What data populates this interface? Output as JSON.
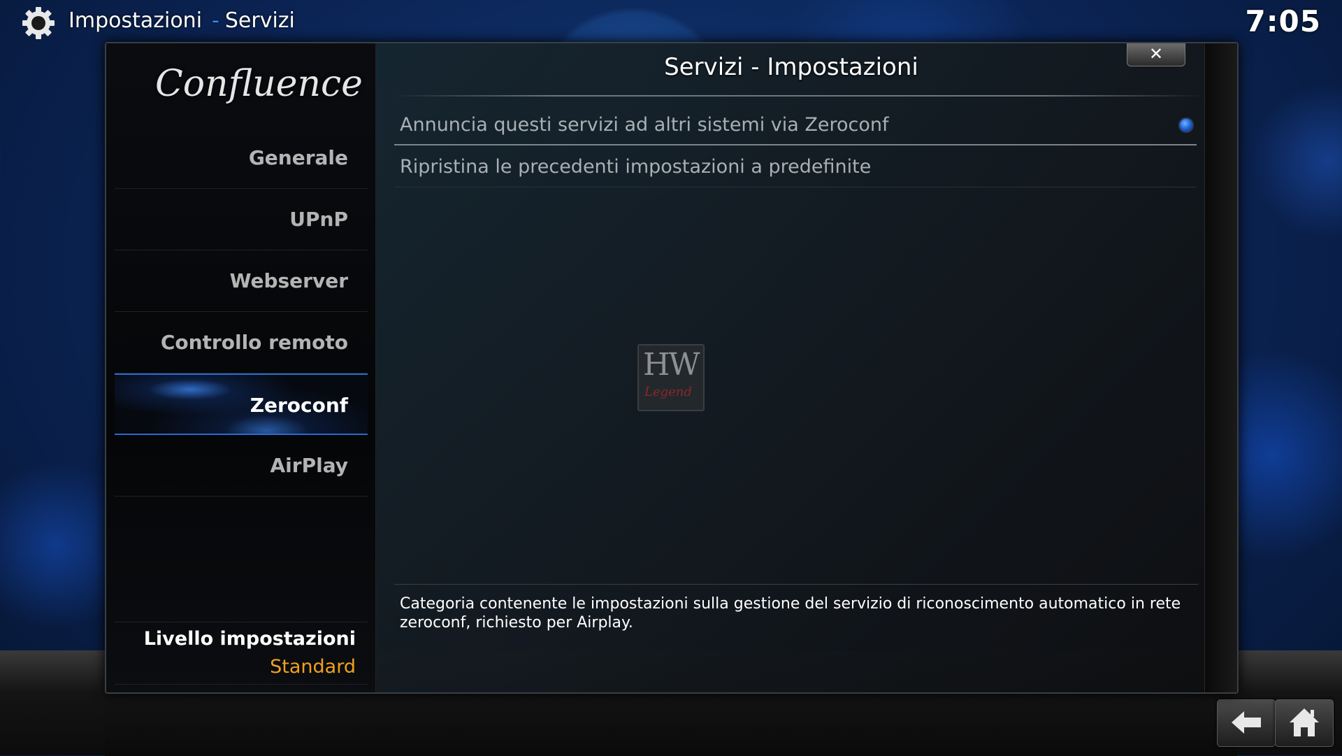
{
  "header": {
    "section": "Impostazioni",
    "separator": "-",
    "page": "Servizi",
    "clock": "7:05",
    "icon": "gear-icon"
  },
  "dialog": {
    "logo": "Confluence",
    "title": "Servizi - Impostazioni",
    "close_label": "✕"
  },
  "sidebar": {
    "items": [
      {
        "label": "Generale"
      },
      {
        "label": "UPnP"
      },
      {
        "label": "Webserver"
      },
      {
        "label": "Controllo remoto"
      },
      {
        "label": "Zeroconf",
        "active": true
      },
      {
        "label": "AirPlay"
      }
    ],
    "level_label": "Livello impostazioni",
    "level_value": "Standard",
    "level_value_color": "#f0a020"
  },
  "settings": [
    {
      "label": "Annuncia questi servizi ad altri sistemi via Zeroconf",
      "enabled": true
    },
    {
      "label": "Ripristina le precedenti impostazioni a predefinite"
    }
  ],
  "watermark": {
    "top_text": "HW",
    "bottom_text": "Legend"
  },
  "description": "Categoria contenente le impostazioni sulla gestione del servizio di riconoscimento automatico in rete zeroconf, richiesto per Airplay.",
  "nav": {
    "back_icon": "back-arrow-icon",
    "home_icon": "home-icon"
  },
  "colors": {
    "accent": "#2a6ad0",
    "radio": "#1e63d6"
  }
}
